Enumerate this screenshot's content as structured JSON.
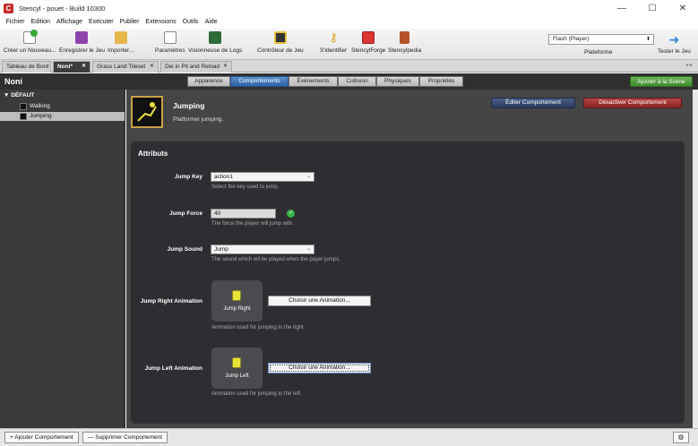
{
  "window": {
    "title": "Stencyl - pouet - Build 10300",
    "min": "—",
    "max": "☐",
    "close": "✕"
  },
  "menu": [
    "Fichier",
    "Edition",
    "Affichage",
    "Exécuter",
    "Publier",
    "Extensions",
    "Outils",
    "Aide"
  ],
  "toolbar": {
    "new_game": "Créer un Nouveau...",
    "save_game": "Enregistrer le Jeu",
    "import": "Importer...",
    "settings": "Paramètres",
    "log_viewer": "Visionneuse de Logs",
    "game_controller": "Contrôleur de Jeu",
    "identify": "S'identifier",
    "stencylforge": "StencylForge",
    "stencylpedia": "Stencylpedia",
    "platform_value": "Flash (Player)",
    "platform_label": "Plateforme",
    "test_game": "Tester le Jeu"
  },
  "tabs": [
    {
      "label": "Tableau de Bord",
      "closable": false,
      "active": false
    },
    {
      "label": "Noni*",
      "closable": true,
      "active": true
    },
    {
      "label": "Grass Land Tileset",
      "closable": true,
      "active": false
    },
    {
      "label": "Die in Pit and Reload",
      "closable": true,
      "active": false
    }
  ],
  "tab_close": "✕",
  "tab_arrows": "◂ ▸",
  "header": {
    "title": "Noni",
    "segments": [
      "Apparence",
      "Comportements",
      "Évènements",
      "Collision",
      "Physiques",
      "Propriétés"
    ],
    "active_segment": "Comportements",
    "add_to_scene": "Ajouter à la Scène"
  },
  "sidebar": {
    "group": "▼ DÉFAUT",
    "items": [
      {
        "label": "Walking",
        "selected": false
      },
      {
        "label": "Jumping",
        "selected": true
      }
    ]
  },
  "behavior": {
    "name": "Jumping",
    "description": "Platformer jumping.",
    "edit_button": "Éditer Comportement",
    "disable_button": "Désactiver Comportement"
  },
  "attributes": {
    "title": "Attributs",
    "jump_key": {
      "label": "Jump Key",
      "value": "action1",
      "help": "Select the key used to jump."
    },
    "jump_force": {
      "label": "Jump Force",
      "value": "40",
      "help": "The force the player will jump with."
    },
    "jump_sound": {
      "label": "Jump Sound",
      "value": "Jump",
      "help": "The sound which wil be played when the payer jumps."
    },
    "jump_right": {
      "label": "Jump Right Animation",
      "anim": "Jump Right",
      "button": "Choisir une Animation...",
      "help": "Animation used for jumping to the right."
    },
    "jump_left": {
      "label": "Jump Left Animation",
      "anim": "Jump Left",
      "button": "Choisir une Animation...",
      "help": "Animation used for jumping to the left."
    }
  },
  "footer": {
    "add": "+  Ajouter Comportement",
    "remove": "—  Supprimer Comportement",
    "gear": "⚙"
  }
}
